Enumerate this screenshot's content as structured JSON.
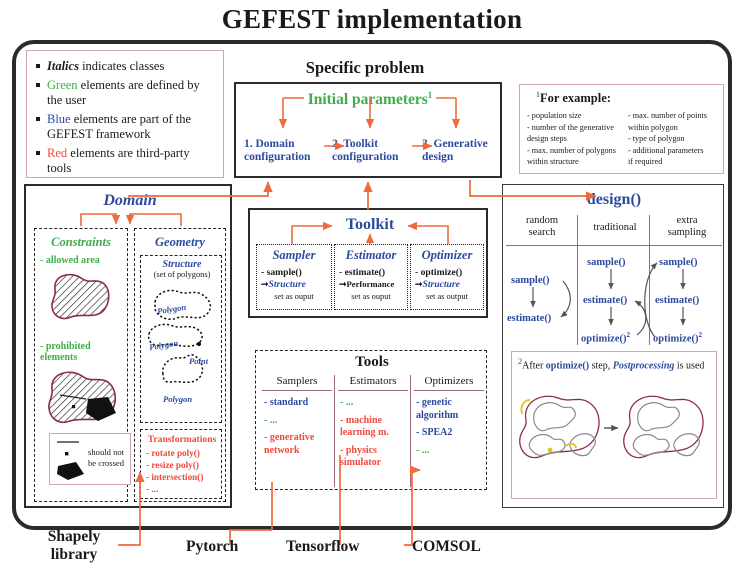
{
  "title": "GEFEST implementation",
  "colors": {
    "green": "#3fae4a",
    "blue": "#2c4a9e",
    "red": "#ef4a3a",
    "orange_arrow": "#ef6a3d",
    "mauve_rule": "#9b6b7a",
    "dark_red_shape": "#8c2b4a",
    "yellow_highlight": "#e8c21a"
  },
  "legend": {
    "items": [
      {
        "accent": "Italics",
        "accent_color": "black",
        "accent_style": "italic-bold",
        "rest": " indicates classes"
      },
      {
        "accent": "Green",
        "accent_color": "green",
        "accent_style": "normal",
        "rest": " elements are defined by the user"
      },
      {
        "accent": "Blue",
        "accent_color": "blue",
        "accent_style": "normal",
        "rest": " elements are part of the GEFEST framework"
      },
      {
        "accent": "Red",
        "accent_color": "red",
        "accent_style": "normal",
        "rest": " elements are third-party tools"
      }
    ]
  },
  "specific_problem": {
    "heading": "Specific problem",
    "initial_parameters": "Initial parameters",
    "initial_parameters_sup": "1",
    "steps": [
      {
        "num": "1.",
        "line1": "1. Domain",
        "line2": "configuration"
      },
      {
        "num": "2.",
        "line1": "2. Toolkit",
        "line2": "configuration"
      },
      {
        "num": "3.",
        "line1": "3. Generative",
        "line2": "design"
      }
    ]
  },
  "footnote": {
    "sup": "1",
    "heading": "For example:",
    "left": [
      "- population size",
      "- number of the generative",
      "   design steps",
      "- max. number of polygons",
      "   within structure"
    ],
    "right": [
      "- max. number of points",
      "   within polygon",
      "- type of polygon",
      "- additional parameters",
      "   if required"
    ]
  },
  "domain": {
    "title": "Domain",
    "constraints": {
      "title": "Constraints",
      "item_allowed": "- allowed area",
      "item_prohibited_l1": "- prohibited",
      "item_prohibited_l2": "   elements",
      "legend_l1": "should not",
      "legend_l2": "be crossed"
    },
    "geometry": {
      "title": "Geometry",
      "structure_title": "Structure",
      "structure_sub": "(set of polygons)",
      "labels": {
        "polygon_top": "Polygon",
        "polygon_mid": "Polygon",
        "point": "Point",
        "polygon_bottom": "Polygon"
      },
      "transformations": {
        "title": "Transformations",
        "items": [
          "- rotate poly()",
          "- resize poly()",
          "- intersection()",
          "- ..."
        ]
      }
    }
  },
  "toolkit": {
    "title": "Toolkit",
    "columns": [
      {
        "name": "Sampler",
        "method": "- sample()",
        "output_type": "Structure",
        "output_note": "set as ouput"
      },
      {
        "name": "Estimator",
        "method": "- estimate()",
        "output_type": "Performance",
        "output_note": "set as ouput"
      },
      {
        "name": "Optimizer",
        "method": "- optimize()",
        "output_type": "Structure",
        "output_note": "set as output"
      }
    ]
  },
  "tools": {
    "title": "Tools",
    "columns": [
      {
        "header": "Samplers",
        "items": [
          {
            "text": "- standard",
            "color": "blue"
          },
          {
            "text": "- ...",
            "color": "green"
          },
          {
            "text": "- generative network",
            "color": "red"
          }
        ]
      },
      {
        "header": "Estimators",
        "items": [
          {
            "text": "- ...",
            "color": "green"
          },
          {
            "text": "- machine learning m.",
            "color": "red"
          },
          {
            "text": "- physics simulator",
            "color": "red"
          }
        ]
      },
      {
        "header": "Optimizers",
        "items": [
          {
            "text": "- genetic algorithm",
            "color": "blue"
          },
          {
            "text": "- SPEA2",
            "color": "blue"
          },
          {
            "text": "- ...",
            "color": "green"
          }
        ]
      }
    ]
  },
  "design": {
    "title": "design()",
    "columns": [
      {
        "header_l1": "random",
        "header_l2": "search",
        "steps": [
          "sample()",
          "estimate()"
        ]
      },
      {
        "header_l1": "traditional",
        "header_l2": "",
        "steps": [
          "sample()",
          "estimate()",
          "optimize()"
        ]
      },
      {
        "header_l1": "extra",
        "header_l2": "sampling",
        "steps": [
          "sample()",
          "estimate()",
          "optimize()"
        ]
      }
    ],
    "optimize_sup": "2",
    "postprocessing": {
      "sup": "2",
      "text_before": "After ",
      "code": "optimize()",
      "text_mid": " step, ",
      "emphasis": "Postprocessing",
      "text_after": " is used"
    }
  },
  "external_tools": [
    {
      "name": "Shapely library",
      "l1": "Shapely",
      "l2": "library"
    },
    {
      "name": "Pytorch",
      "l1": "Pytorch",
      "l2": ""
    },
    {
      "name": "Tensorflow",
      "l1": "Tensorflow",
      "l2": ""
    },
    {
      "name": "COMSOL",
      "l1": "COMSOL",
      "l2": ""
    }
  ]
}
